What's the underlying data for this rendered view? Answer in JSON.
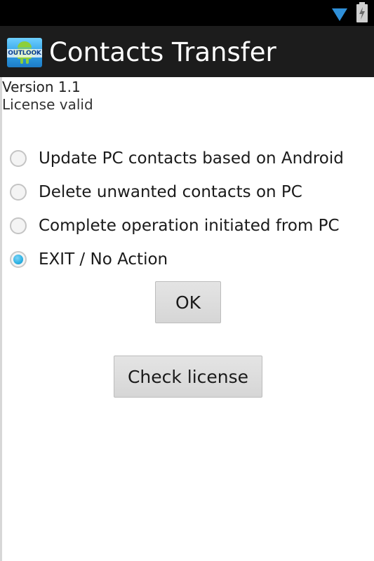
{
  "status_bar": {
    "icons": [
      "wifi-icon",
      "battery-icon"
    ]
  },
  "action_bar": {
    "app_icon_text": "OUTLOOK",
    "title": "Contacts Transfer"
  },
  "info": {
    "version": "Version 1.1",
    "license_status": "License valid"
  },
  "options": [
    {
      "label": "Update PC contacts based on Android",
      "checked": false
    },
    {
      "label": "Delete unwanted contacts on PC",
      "checked": false
    },
    {
      "label": "Complete operation initiated from PC",
      "checked": false
    },
    {
      "label": "EXIT / No Action",
      "checked": true
    }
  ],
  "buttons": {
    "ok_label": "OK",
    "check_license_label": "Check license"
  },
  "colors": {
    "action_bar": "#1c1c1c",
    "status_bar": "#000000",
    "radio_accent": "#33b5e5",
    "button": "#d9d9d9"
  }
}
